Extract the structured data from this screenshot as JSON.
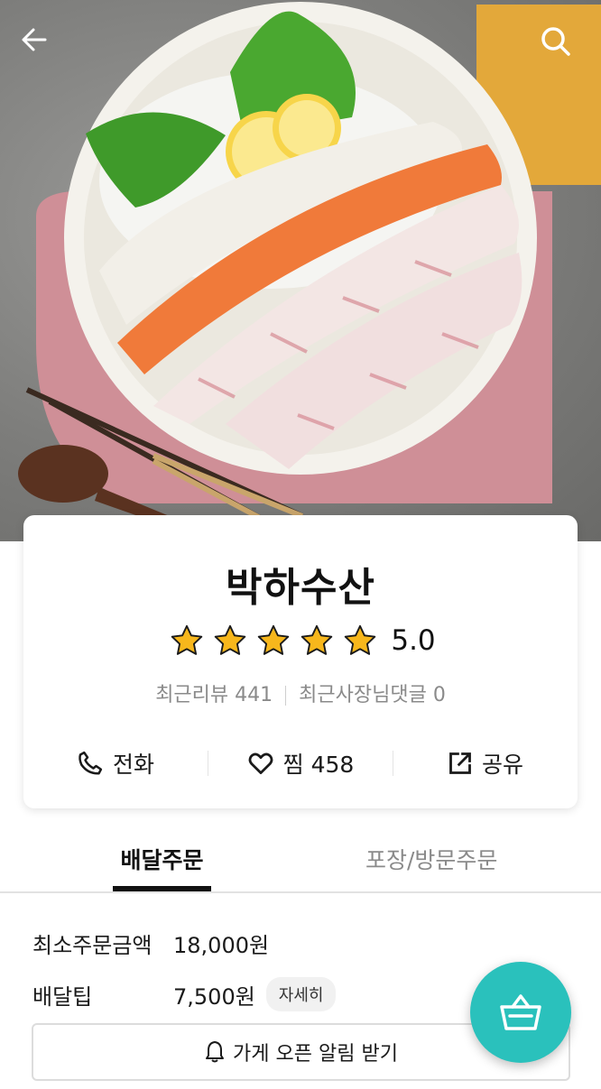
{
  "store": {
    "name": "박하수산",
    "rating": 5.0,
    "rating_text": "5.0",
    "stars": 5,
    "recent_reviews_label": "최근리뷰 441",
    "owner_replies_label": "최근사장님댓글 0"
  },
  "actions": {
    "call_label": "전화",
    "favorite_label": "찜 458",
    "share_label": "공유"
  },
  "tabs": [
    {
      "label": "배달주문",
      "active": true
    },
    {
      "label": "포장/방문주문",
      "active": false
    }
  ],
  "delivery_info": {
    "min_order_label": "최소주문금액",
    "min_order_value": "18,000원",
    "tip_label": "배달팁",
    "tip_value": "7,500원",
    "detail_label": "자세히"
  },
  "notify_button": "가게 오픈 알림 받기",
  "colors": {
    "accent": "#2ac1bc",
    "star": "#f7b71c"
  },
  "icons": {
    "back": "arrow-left-icon",
    "search": "search-icon",
    "call": "phone-icon",
    "favorite": "heart-icon",
    "share": "share-icon",
    "notify": "bell-icon",
    "cart": "basket-icon"
  }
}
